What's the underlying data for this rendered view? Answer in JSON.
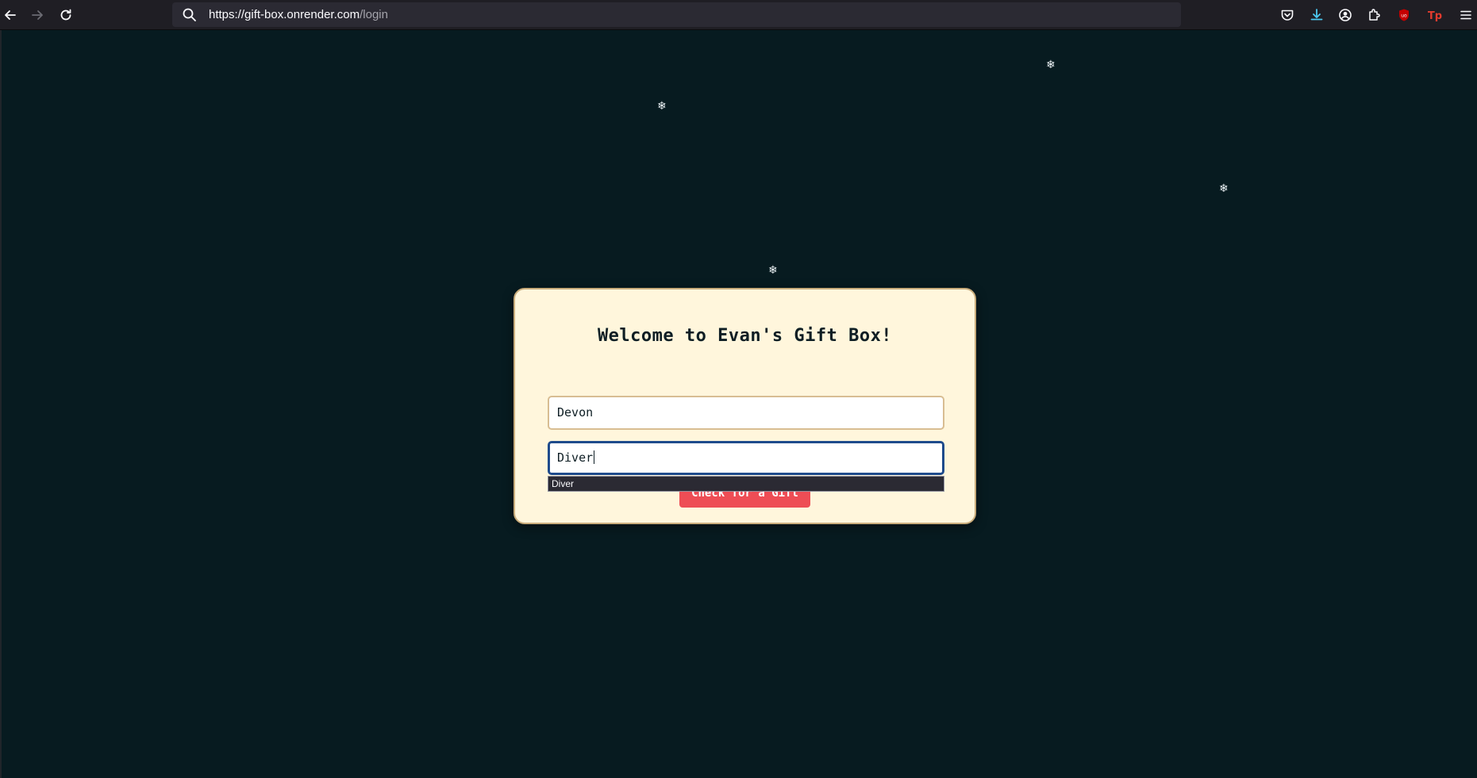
{
  "browser": {
    "url_host": "https://gift-box.onrender.com",
    "url_path": "/login",
    "icons": [
      "back-icon",
      "forward-icon",
      "reload-icon",
      "search-icon",
      "pocket-icon",
      "downloads-icon",
      "account-icon",
      "extensions-icon",
      "ublock-icon",
      "tp-extension-icon",
      "menu-icon"
    ],
    "colors": {
      "downloads": "#4cc9f0",
      "ublock": "#c50000",
      "tp": "#e33b2e"
    }
  },
  "page": {
    "background": "#071b20",
    "snowflake_glyph": "❄",
    "card": {
      "title": "Welcome to Evan's Gift Box!",
      "name_field_value": "Devon",
      "second_field_value": "Diver",
      "autocomplete_option": "Diver",
      "button_label": "Check for a Gift",
      "button_color": "#ee4d55",
      "card_color": "#fff6dc"
    }
  }
}
